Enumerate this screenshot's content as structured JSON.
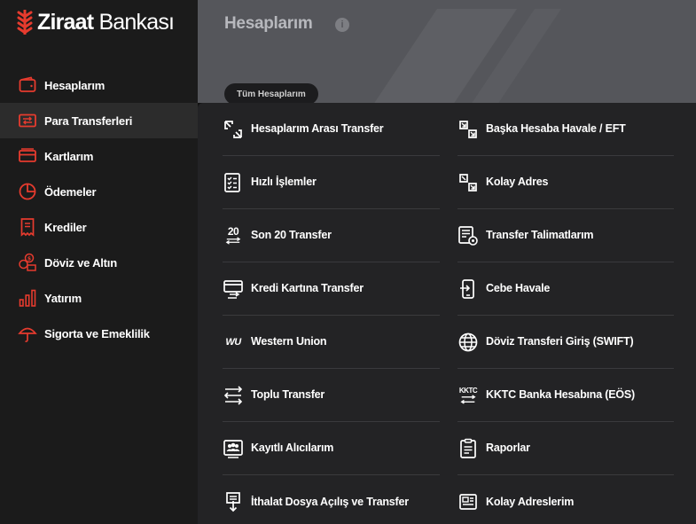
{
  "brand": {
    "name_bold": "Ziraat",
    "name_regular": "Bankası",
    "accent": "#e63b2e"
  },
  "sidebar": {
    "items": [
      {
        "label": "Hesaplarım",
        "icon": "wallet-icon",
        "active": false
      },
      {
        "label": "Para Transferleri",
        "icon": "transfer-icon",
        "active": true
      },
      {
        "label": "Kartlarım",
        "icon": "card-icon",
        "active": false
      },
      {
        "label": "Ödemeler",
        "icon": "pie-chart-icon",
        "active": false
      },
      {
        "label": "Krediler",
        "icon": "receipt-icon",
        "active": false
      },
      {
        "label": "Döviz ve Altın",
        "icon": "coins-icon",
        "active": false
      },
      {
        "label": "Yatırım",
        "icon": "bar-chart-icon",
        "active": false
      },
      {
        "label": "Sigorta ve Emeklilik",
        "icon": "umbrella-icon",
        "active": false
      }
    ]
  },
  "header": {
    "title": "Hesaplarım",
    "info_glyph": "i",
    "tab_label": "Tüm Hesaplarım"
  },
  "menu": {
    "left": [
      {
        "label": "Hesaplarım Arası Transfer",
        "icon": "swap-arrows-icon"
      },
      {
        "label": "Hızlı İşlemler",
        "icon": "checklist-icon"
      },
      {
        "label": "Son 20 Transfer",
        "icon": "last-20-icon",
        "icon_text": "20"
      },
      {
        "label": "Kredi Kartına Transfer",
        "icon": "card-transfer-icon"
      },
      {
        "label": "Western Union",
        "icon": "western-union-icon",
        "icon_text": "WU"
      },
      {
        "label": "Toplu Transfer",
        "icon": "bulk-transfer-icon"
      },
      {
        "label": "Kayıtlı Alıcılarım",
        "icon": "saved-recipients-icon"
      },
      {
        "label": "İthalat Dosya Açılış ve Transfer",
        "icon": "import-file-icon"
      }
    ],
    "right": [
      {
        "label": "Başka Hesaba Havale / EFT",
        "icon": "eft-arrows-icon"
      },
      {
        "label": "Kolay Adres",
        "icon": "easy-address-icon"
      },
      {
        "label": "Transfer Talimatlarım",
        "icon": "instructions-icon"
      },
      {
        "label": "Cebe Havale",
        "icon": "mobile-transfer-icon"
      },
      {
        "label": "Döviz Transferi Giriş (SWIFT)",
        "icon": "globe-icon"
      },
      {
        "label": "KKTC Banka Hesabına (EÖS)",
        "icon": "kktc-icon",
        "icon_text": "KKTC"
      },
      {
        "label": "Raporlar",
        "icon": "report-icon"
      },
      {
        "label": "Kolay Adreslerim",
        "icon": "address-list-icon"
      }
    ]
  }
}
